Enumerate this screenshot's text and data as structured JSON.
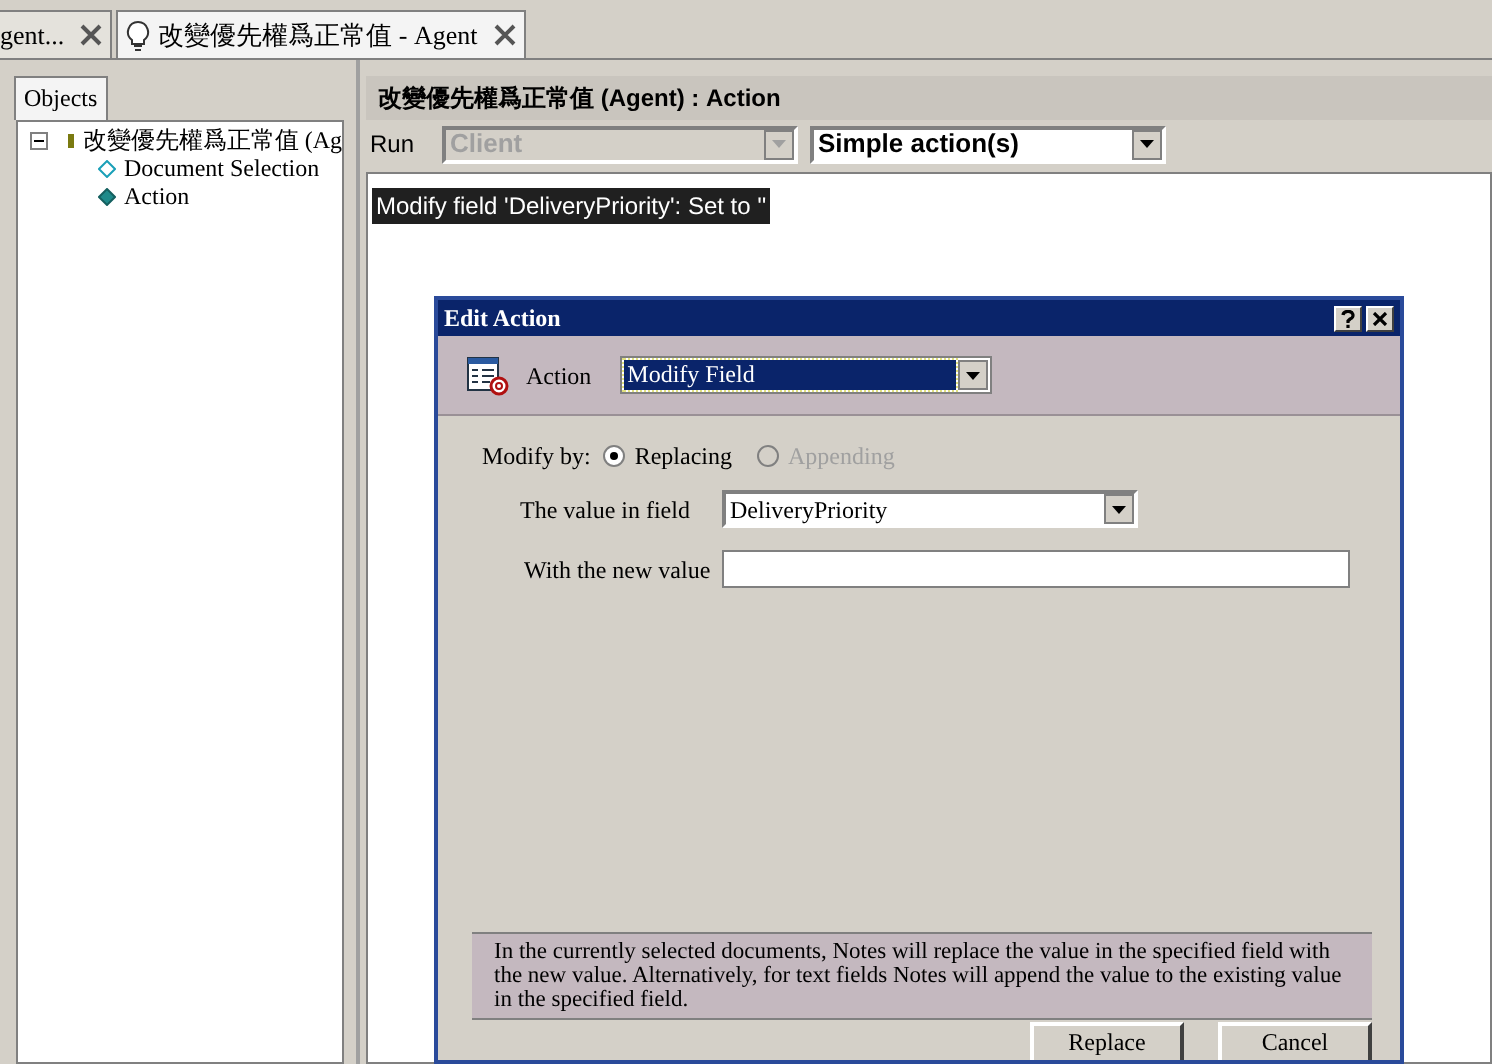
{
  "tabs": [
    {
      "label": "gent...",
      "selected": false,
      "kind": "plain"
    },
    {
      "label": "改變優先權爲正常值 - Agent",
      "selected": true,
      "kind": "agent"
    }
  ],
  "sidebar": {
    "tab": "Objects",
    "tree": [
      {
        "label": "改變優先權爲正常值 (Ag",
        "kind": "agent",
        "expanded": true,
        "children": [
          {
            "label": "Document Selection",
            "kind": "selection"
          },
          {
            "label": "Action",
            "kind": "action"
          }
        ]
      }
    ]
  },
  "editor": {
    "title": "改變優先權爲正常值 (Agent) : Action",
    "run_label": "Run",
    "trigger": {
      "value": "Client",
      "disabled": true
    },
    "type": {
      "value": "Simple action(s)",
      "disabled": false
    },
    "actions": [
      {
        "text": "Modify field 'DeliveryPriority': Set to ''",
        "selected": true
      }
    ]
  },
  "dialog": {
    "title": "Edit Action",
    "action_label": "Action",
    "action_value": "Modify Field",
    "modify_label": "Modify by:",
    "modes": [
      {
        "label": "Replacing",
        "selected": true,
        "disabled": false
      },
      {
        "label": "Appending",
        "selected": false,
        "disabled": true
      }
    ],
    "field_label": "The value in field",
    "field_value": "DeliveryPriority",
    "new_value_label": "With the new value",
    "info": "In the currently selected documents, Notes will replace the value in the specified field with the new value.  Alternatively, for text fields Notes will append the value to the existing value in the specified field.",
    "buttons": [
      "Replace",
      "Cancel"
    ]
  }
}
